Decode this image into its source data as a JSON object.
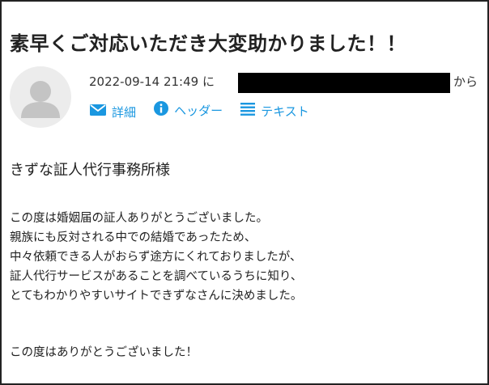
{
  "email": {
    "subject": "素早くご対応いただき大変助かりました！！",
    "datetime": "2022-09-14 21:49",
    "to_particle": "に",
    "from_suffix": "から",
    "actions": {
      "details": "詳細",
      "header": "ヘッダー",
      "text": "テキスト"
    },
    "greeting": "きずな証人代行事務所様",
    "body_lines": [
      "この度は婚姻届の証人ありがとうございました。",
      "親族にも反対される中での結婚であったため、",
      "中々依頼できる人がおらず途方にくれておりましたが、",
      "証人代行サービスがあることを調べているうちに知り、",
      "とてもわかりやすいサイトできずなさんに決めました。"
    ],
    "closing": "この度はありがとうございました！"
  },
  "colors": {
    "link": "#1a97e0",
    "avatar_bg": "#ececec",
    "avatar_fg": "#c4c4c4"
  },
  "icons": {
    "avatar": "user-silhouette-icon",
    "details": "envelope-icon",
    "header": "info-icon",
    "text": "list-lines-icon"
  }
}
